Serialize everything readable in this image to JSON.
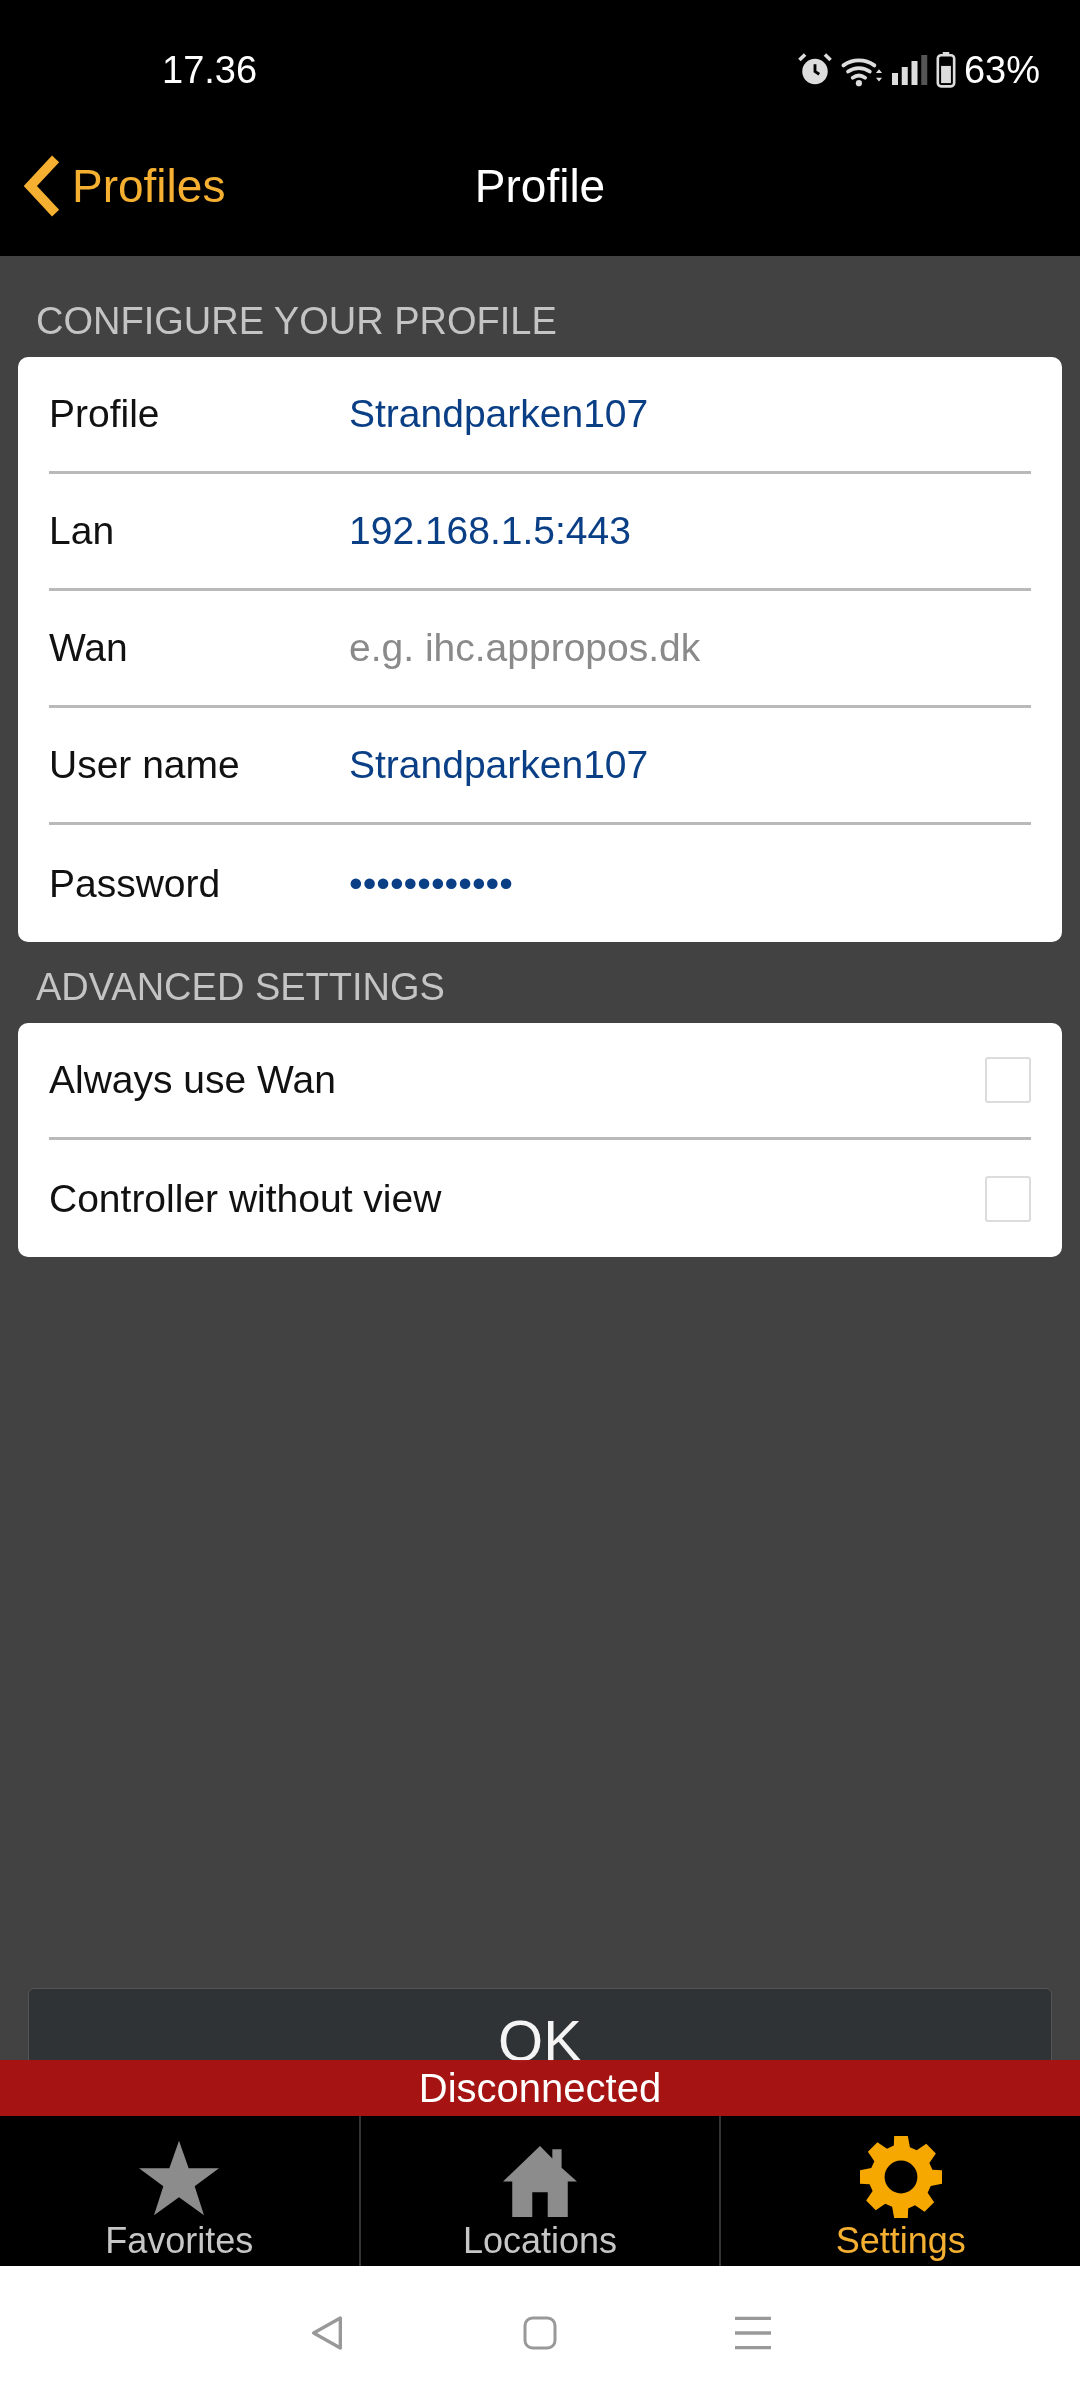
{
  "status_bar": {
    "time": "17.36",
    "battery": "63%"
  },
  "nav_bar": {
    "back_label": "Profiles",
    "title": "Profile"
  },
  "profile_section": {
    "header": "CONFIGURE YOUR PROFILE",
    "fields": [
      {
        "label": "Profile",
        "value": "Strandparken107"
      },
      {
        "label": "Lan",
        "value": "192.168.1.5:443"
      },
      {
        "label": "Wan",
        "placeholder": "e.g. ihc.appropos.dk"
      },
      {
        "label": "User name",
        "value": "Strandparken107"
      },
      {
        "label": "Password",
        "value": "••••••••••••"
      }
    ]
  },
  "advanced_section": {
    "header": "ADVANCED SETTINGS",
    "options": [
      {
        "label": "Always use Wan",
        "checked": false
      },
      {
        "label": "Controller without view",
        "checked": false
      }
    ]
  },
  "ok_button": "OK",
  "connection_banner": "Disconnected",
  "tabs": [
    {
      "kind": "star",
      "label": "Favorites",
      "selected": false
    },
    {
      "kind": "house",
      "label": "Locations",
      "selected": false
    },
    {
      "kind": "gear",
      "label": "Settings",
      "selected": true
    }
  ]
}
